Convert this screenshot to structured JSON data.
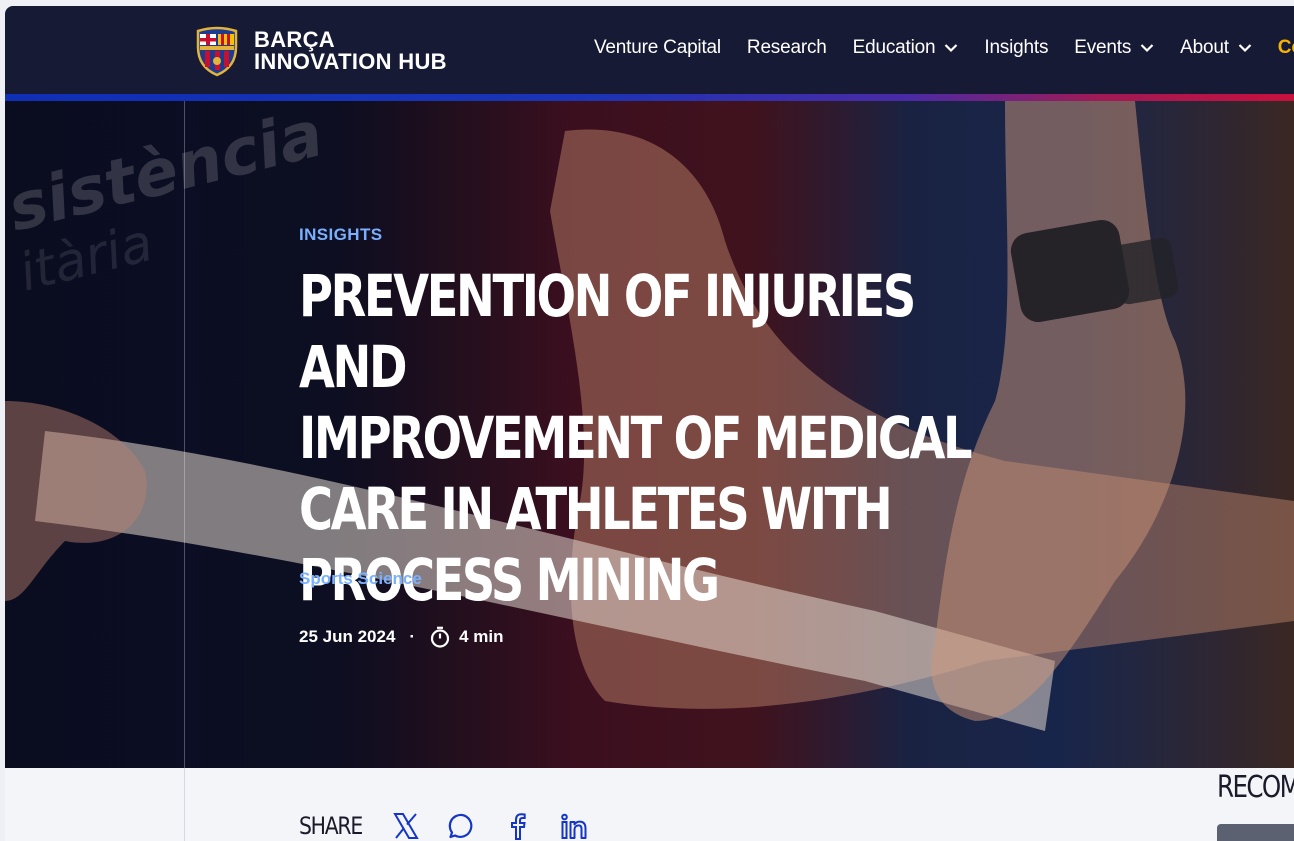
{
  "brand": {
    "line1": "BARÇA",
    "line2": "INNOVATION HUB",
    "crest_text": "FCB"
  },
  "nav": {
    "items": [
      {
        "label": "Venture Capital",
        "dropdown": false
      },
      {
        "label": "Research",
        "dropdown": false
      },
      {
        "label": "Education",
        "dropdown": true
      },
      {
        "label": "Insights",
        "dropdown": false
      },
      {
        "label": "Events",
        "dropdown": true
      },
      {
        "label": "About",
        "dropdown": true
      }
    ],
    "cta_partial": "Co"
  },
  "hero": {
    "category": "INSIGHTS",
    "title": "PREVENTION OF INJURIES AND IMPROVEMENT OF MEDICAL CARE IN ATHLETES WITH PROCESS MINING",
    "title_lines": [
      "PREVENTION OF INJURIES AND",
      "IMPROVEMENT OF MEDICAL",
      "CARE IN ATHLETES WITH",
      "PROCESS MINING"
    ],
    "tag": "Sports Science",
    "date": "25 Jun 2024",
    "separator": "·",
    "read_time": "4 min",
    "bg_text_1": "sistència",
    "bg_text_2": "itària"
  },
  "share": {
    "label": "SHARE",
    "icons": [
      "x-icon",
      "whatsapp-icon",
      "facebook-icon",
      "linkedin-icon"
    ]
  },
  "sidebar": {
    "heading_partial": "RECOM"
  },
  "colors": {
    "header_bg": "#171a35",
    "accent_blue": "#7ab1ff",
    "cta_gold": "#f6b300",
    "gradient_start": "#0f2fb5",
    "gradient_end": "#c8103e"
  }
}
